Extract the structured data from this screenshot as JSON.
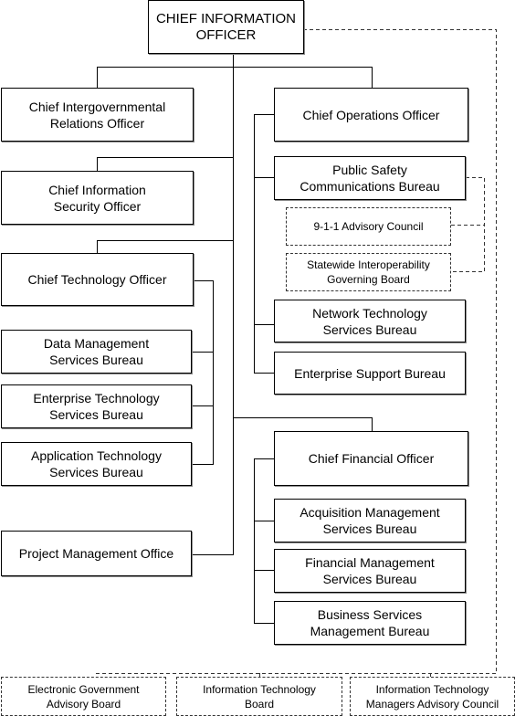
{
  "chart": {
    "cio": "CHIEF INFORMATION\nOFFICER",
    "ciro": "Chief Intergovernmental\nRelations Officer",
    "ciso": "Chief Information\nSecurity Officer",
    "cto": "Chief Technology Officer",
    "dmsb": "Data Management\nServices Bureau",
    "etsb": "Enterprise Technology\nServices Bureau",
    "atsb": "Application Technology\nServices Bureau",
    "pmo": "Project Management Office",
    "coo": "Chief Operations Officer",
    "pscb": "Public Safety\nCommunications Bureau",
    "advisory911": "9-1-1 Advisory Council",
    "sigb": "Statewide Interoperability\nGoverning Board",
    "ntsb": "Network Technology\nServices Bureau",
    "esb": "Enterprise Support Bureau",
    "cfo": "Chief Financial Officer",
    "amsb": "Acquisition Management\nServices Bureau",
    "fmsb": "Financial Management\nServices Bureau",
    "bsmb": "Business Services\nManagement Bureau",
    "egab": "Electronic Government\nAdvisory Board",
    "itb": "Information Technology\nBoard",
    "itmac": "Information Technology\nManagers Advisory Council"
  }
}
